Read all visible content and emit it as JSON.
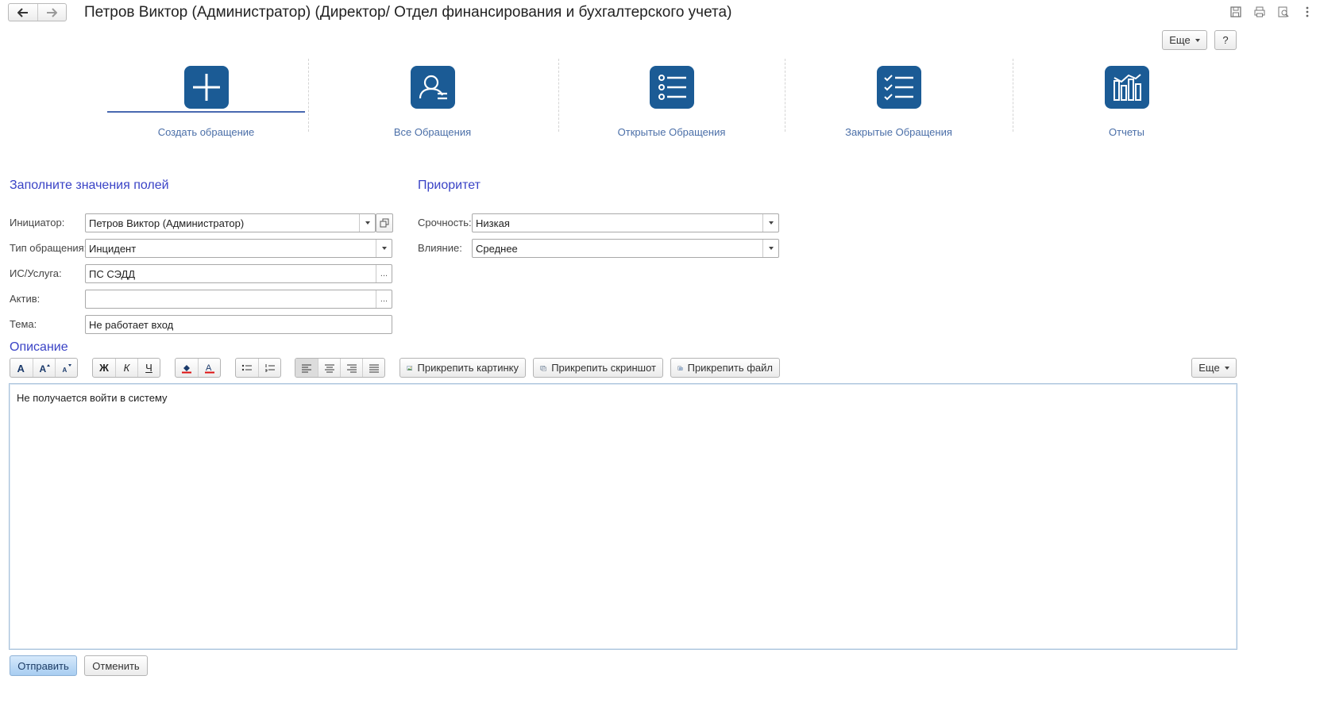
{
  "window": {
    "title": "Петров Виктор (Администратор) (Директор/ Отдел финансирования и бухгалтерского учета)"
  },
  "header_buttons": {
    "more_label": "Еще",
    "help_label": "?"
  },
  "tiles": [
    {
      "label": "Создать обращение",
      "icon": "plus-icon",
      "active": true
    },
    {
      "label": "Все Обращения",
      "icon": "user-icon",
      "active": false
    },
    {
      "label": "Открытые Обращения",
      "icon": "list-icon",
      "active": false
    },
    {
      "label": "Закрытые Обращения",
      "icon": "checklist-icon",
      "active": false
    },
    {
      "label": "Отчеты",
      "icon": "chart-icon",
      "active": false
    }
  ],
  "form": {
    "heading": "Заполните значения полей",
    "initiator": {
      "label": "Инициатор:",
      "value": "Петров Виктор (Администратор)"
    },
    "request_type": {
      "label": "Тип обращения:",
      "value": "Инцидент"
    },
    "service": {
      "label": "ИС/Услуга:",
      "value": "ПС СЭДД"
    },
    "asset": {
      "label": "Актив:",
      "value": ""
    },
    "subject": {
      "label": "Тема:",
      "value": "Не работает вход"
    }
  },
  "priority": {
    "heading": "Приоритет",
    "urgency": {
      "label": "Срочность:",
      "value": "Низкая"
    },
    "impact": {
      "label": "Влияние:",
      "value": "Среднее"
    }
  },
  "description": {
    "heading": "Описание",
    "toolbar": {
      "bold_glyph": "Ж",
      "italic_glyph": "К",
      "underline_glyph": "Ч",
      "attach_picture": "Прикрепить картинку",
      "attach_screenshot": "Прикрепить скриншот",
      "attach_file": "Прикрепить файл",
      "more_label": "Еще"
    },
    "text": "Не получается войти в систему"
  },
  "footer": {
    "submit_label": "Отправить",
    "cancel_label": "Отменить"
  },
  "colors": {
    "accent": "#1b5b95",
    "heading": "#3a43c6",
    "tile_label": "#4b6fa8"
  }
}
